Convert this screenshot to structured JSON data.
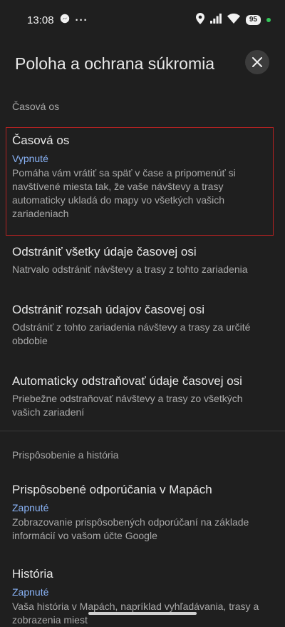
{
  "status_bar": {
    "time": "13:08",
    "dots": "···",
    "battery": "95",
    "green_dot_color": "#34c759"
  },
  "header": {
    "title": "Poloha a ochrana súkromia",
    "close_icon": "close-icon"
  },
  "sections": [
    {
      "label": "Časová os",
      "items": [
        {
          "title": "Časová os",
          "status": "Vypnuté",
          "description": "Pomáha vám vrátiť sa späť v čase a pripomenúť si navštívené miesta tak, že vaše návštevy a trasy automaticky ukladá do mapy vo všetkých vašich zariadeniach"
        },
        {
          "title": "Odstrániť všetky údaje časovej osi",
          "description": "Natrvalo odstrániť návštevy a trasy z tohto zariadenia"
        },
        {
          "title": "Odstrániť rozsah údajov časovej osi",
          "description": "Odstrániť z tohto zariadenia návštevy a trasy za určité obdobie"
        },
        {
          "title": "Automaticky odstraňovať údaje časovej osi",
          "description": "Priebežne odstraňovať návštevy a trasy zo všetkých vašich zariadení"
        }
      ]
    },
    {
      "label": "Prispôsobenie a história",
      "items": [
        {
          "title": "Prispôsobené odporúčania v Mapách",
          "status": "Zapnuté",
          "description": "Zobrazovanie prispôsobených odporúčaní na základe informácií vo vašom účte Google"
        },
        {
          "title": "História",
          "status": "Zapnuté",
          "description": "Vaša história v Mapách, napríklad vyhľadávania, trasy a zobrazenia miest"
        }
      ]
    }
  ],
  "colors": {
    "background": "#1f1f1f",
    "accent_status": "#8ab4f8",
    "highlight_border": "#b22222"
  }
}
